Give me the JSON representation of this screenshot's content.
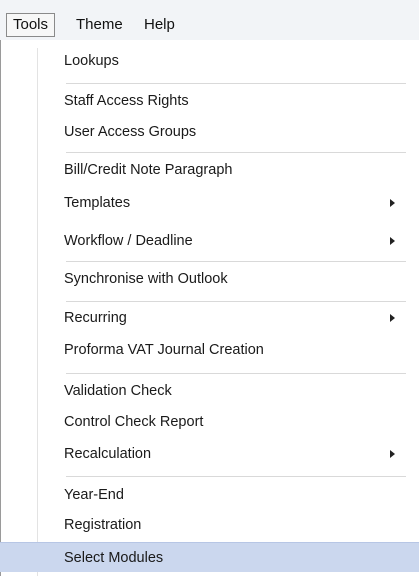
{
  "menubar": {
    "items": [
      {
        "label": "Tools"
      },
      {
        "label": "Theme"
      },
      {
        "label": "Help"
      }
    ]
  },
  "tools_menu": {
    "items": [
      {
        "label": "Lookups"
      },
      {
        "label": "Staff Access Rights"
      },
      {
        "label": "User Access Groups"
      },
      {
        "label": "Bill/Credit Note Paragraph"
      },
      {
        "label": "Templates",
        "submenu": true
      },
      {
        "label": "Workflow / Deadline",
        "submenu": true
      },
      {
        "label": "Synchronise with Outlook"
      },
      {
        "label": "Recurring",
        "submenu": true
      },
      {
        "label": "Proforma VAT Journal Creation"
      },
      {
        "label": "Validation Check"
      },
      {
        "label": "Control Check Report"
      },
      {
        "label": "Recalculation",
        "submenu": true
      },
      {
        "label": "Year-End"
      },
      {
        "label": "Registration"
      },
      {
        "label": "Select Modules",
        "highlighted": true
      }
    ],
    "submenu_icon": "chevron-right-icon",
    "highlight_color": "#cbd7ee"
  }
}
